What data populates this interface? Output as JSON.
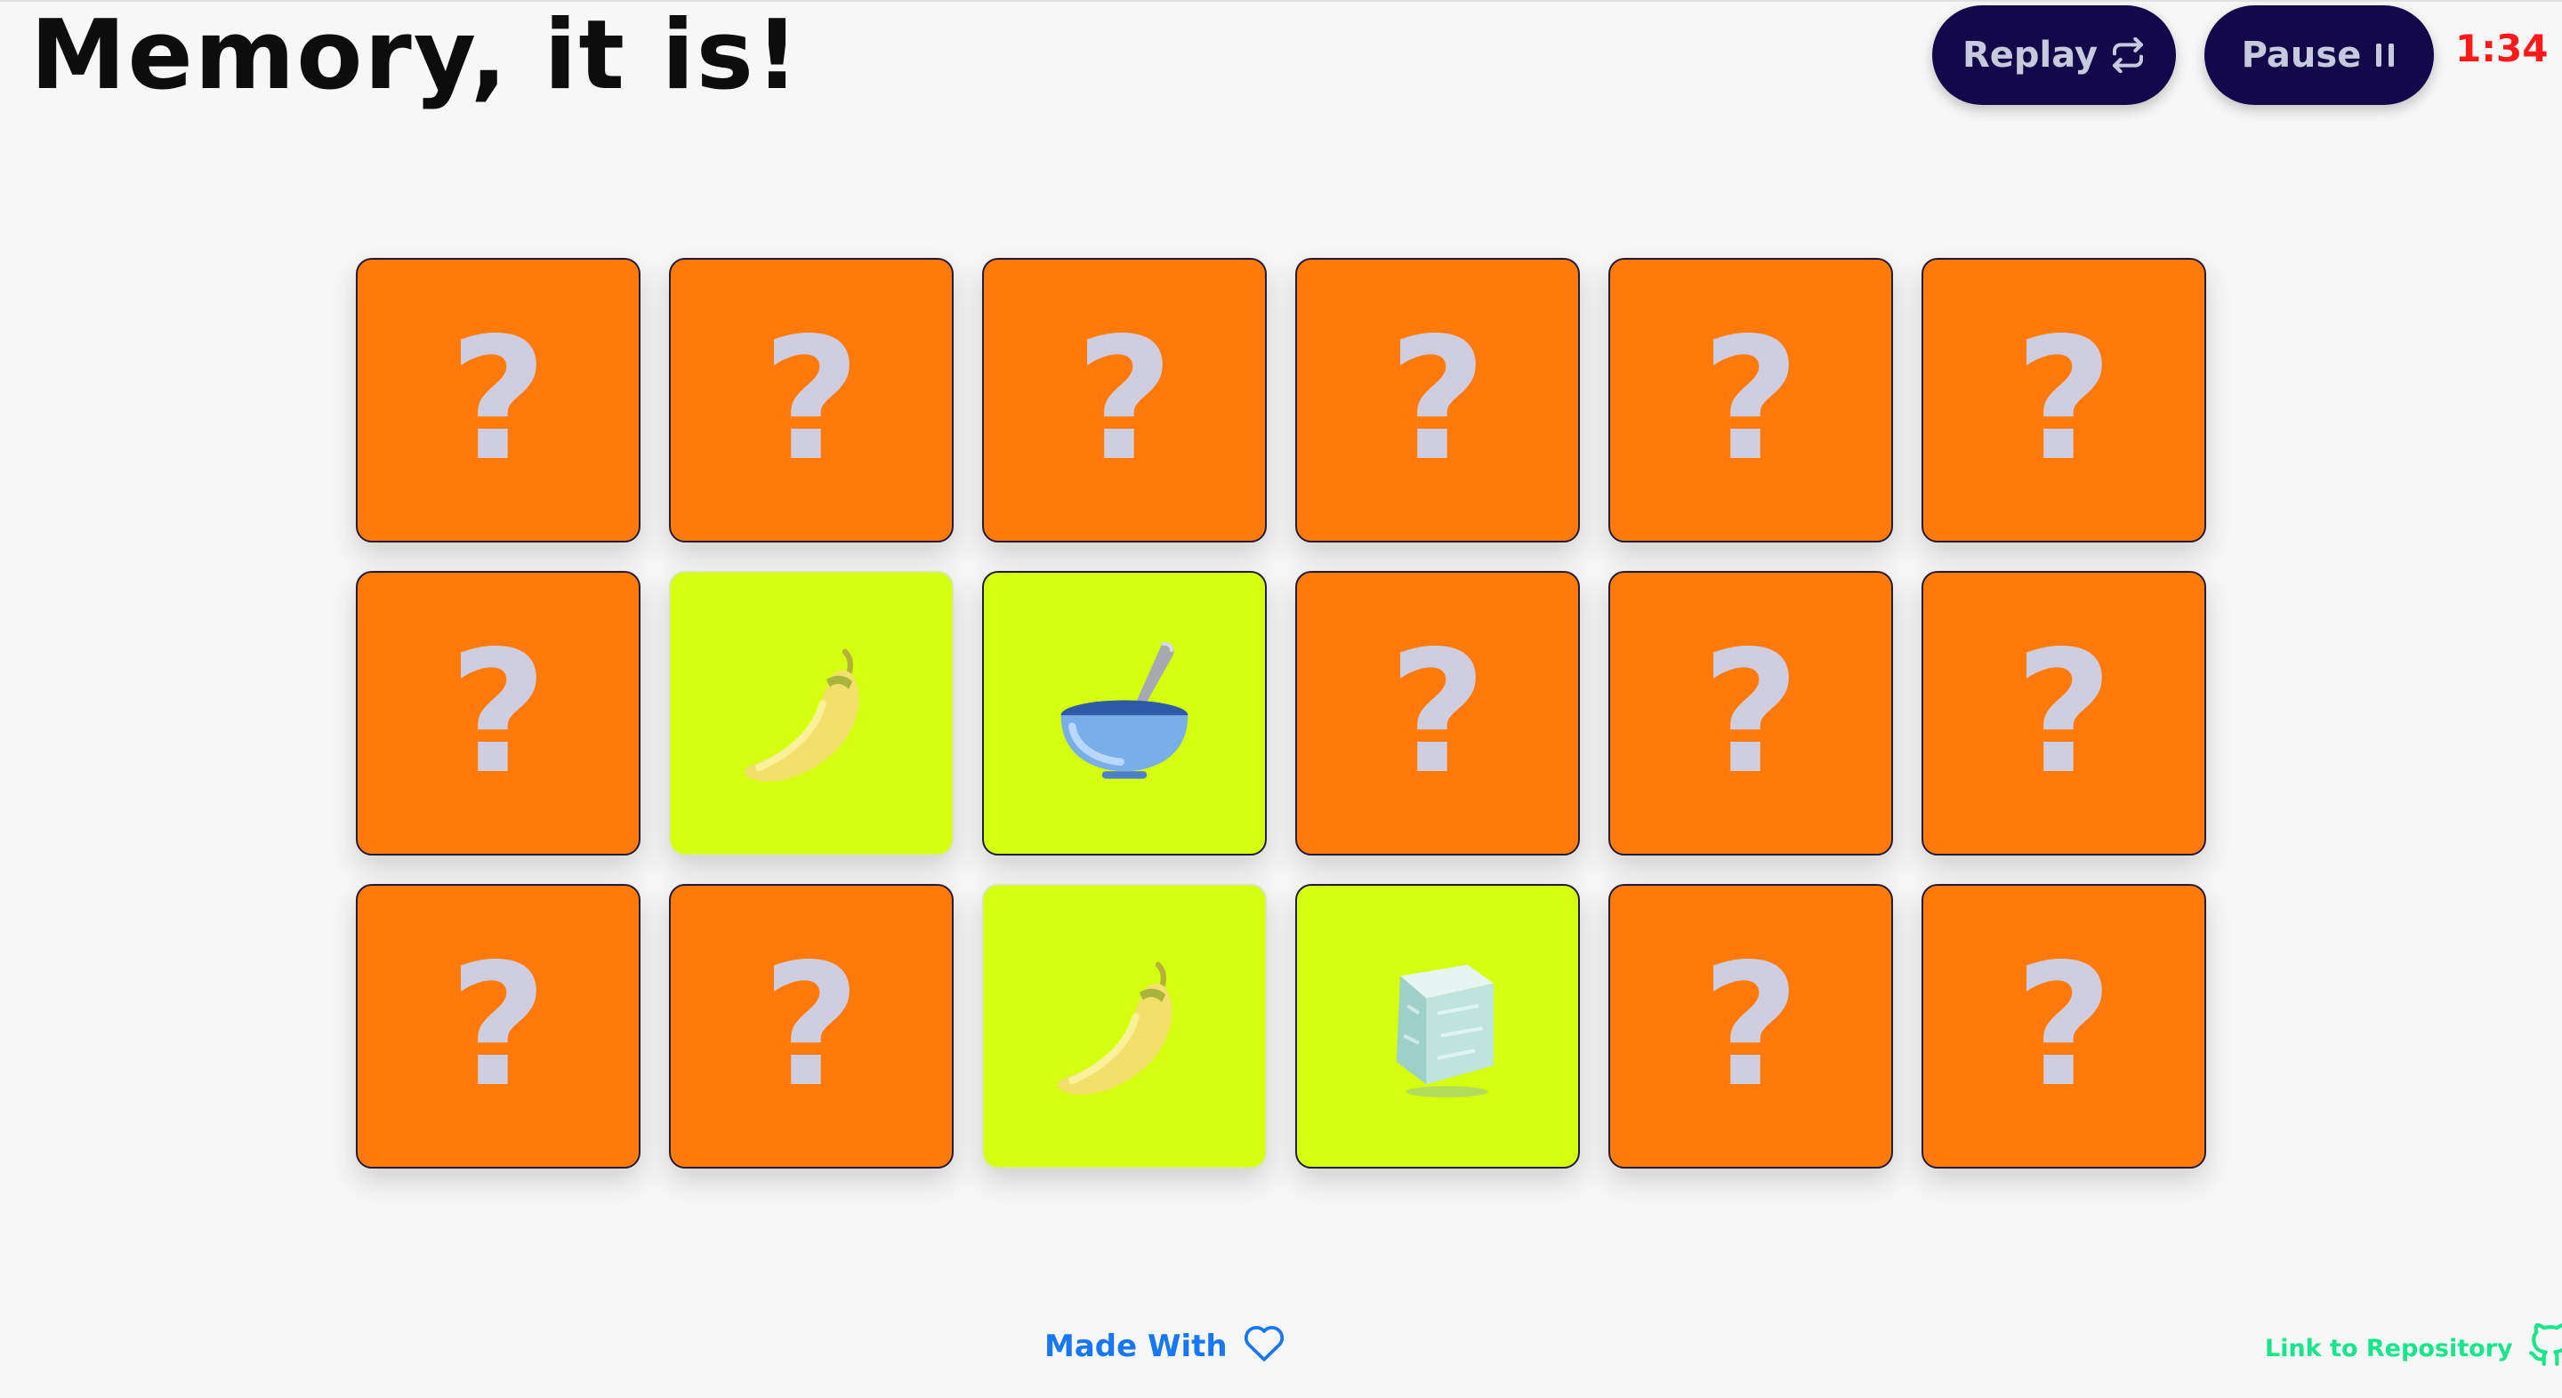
{
  "header": {
    "title": "Memory, it is!",
    "replay_label": "Replay",
    "pause_label": "Pause",
    "timer": "1:34"
  },
  "board": {
    "cards": [
      {
        "state": "hidden",
        "symbol": "?"
      },
      {
        "state": "hidden",
        "symbol": "?"
      },
      {
        "state": "hidden",
        "symbol": "?"
      },
      {
        "state": "hidden",
        "symbol": "?"
      },
      {
        "state": "hidden",
        "symbol": "?"
      },
      {
        "state": "hidden",
        "symbol": "?"
      },
      {
        "state": "hidden",
        "symbol": "?"
      },
      {
        "state": "matched",
        "icon": "chili-pepper-icon"
      },
      {
        "state": "open",
        "icon": "bowl-with-spoon-icon"
      },
      {
        "state": "hidden",
        "symbol": "?"
      },
      {
        "state": "hidden",
        "symbol": "?"
      },
      {
        "state": "hidden",
        "symbol": "?"
      },
      {
        "state": "hidden",
        "symbol": "?"
      },
      {
        "state": "hidden",
        "symbol": "?"
      },
      {
        "state": "matched",
        "icon": "chili-pepper-icon"
      },
      {
        "state": "open",
        "icon": "ice-cube-icon"
      },
      {
        "state": "hidden",
        "symbol": "?"
      },
      {
        "state": "hidden",
        "symbol": "?"
      }
    ]
  },
  "footer": {
    "made_with": "Made With",
    "repo_link": "Link to Repository"
  },
  "colors": {
    "card_back": "#ff7a0a",
    "card_face": "#d4ff0e",
    "button_bg": "#13094a",
    "timer": "#ff1a1a",
    "made_with": "#1877f2",
    "repo_link": "#19e58a"
  }
}
